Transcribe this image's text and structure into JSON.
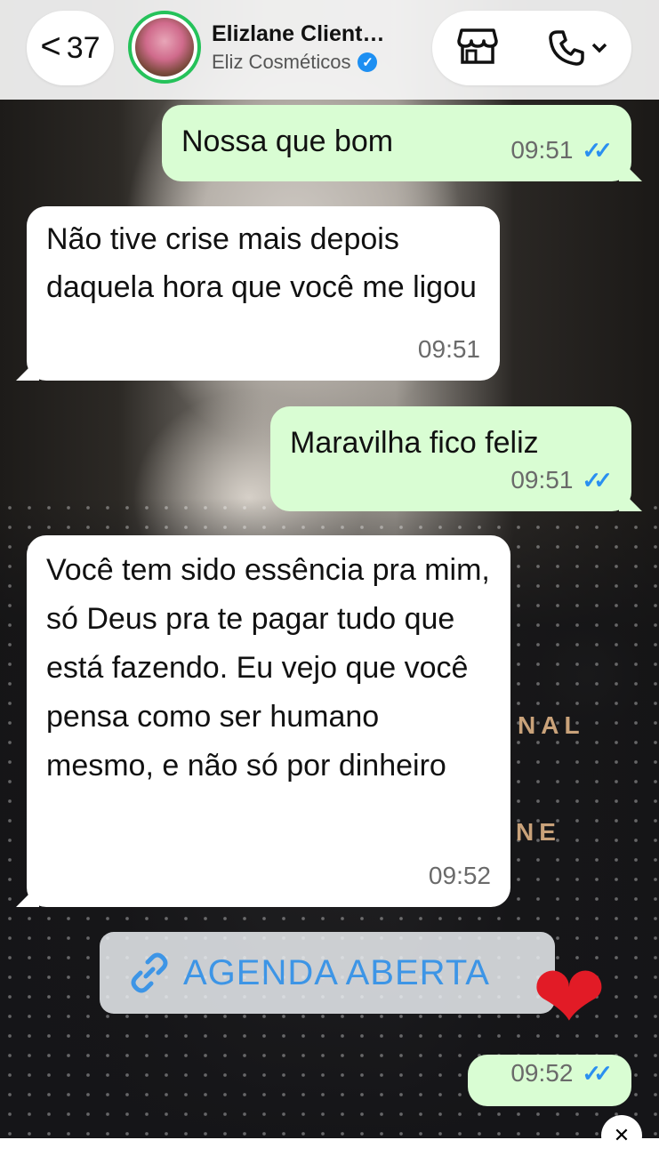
{
  "header": {
    "back_label": "<",
    "unread_count": "37",
    "contact_name": "Elizlane Client…",
    "business_name": "Eliz Cosméticos",
    "verified_mark": "✓"
  },
  "wallpaper_text": [
    "NAL",
    "NE"
  ],
  "messages": [
    {
      "direction": "out",
      "text": "Nossa que bom",
      "time": "09:51",
      "status": "read"
    },
    {
      "direction": "in",
      "text": "Não tive crise mais depois daquela hora que você me ligou",
      "time": "09:51"
    },
    {
      "direction": "out",
      "text": "Maravilha fico feliz",
      "time": "09:51",
      "status": "read"
    },
    {
      "direction": "in",
      "text": "Você tem sido essência pra mim, só Deus pra te pagar tudo que está fazendo. Eu vejo que você pensa como ser humano mesmo, e não só por dinheiro",
      "time": "09:52"
    },
    {
      "direction": "out",
      "text": "",
      "time": "09:52",
      "status": "read",
      "link_preview": "AGENDA ABERTA",
      "emoji": "❤"
    }
  ],
  "colors": {
    "outgoing_bubble": "#d9fdd3",
    "incoming_bubble": "#ffffff",
    "read_ticks": "#2a8ff0",
    "online_ring": "#25c25a",
    "verified_badge": "#1d8ff2"
  },
  "icons": [
    "chevron-left-icon",
    "store-icon",
    "phone-icon",
    "chevron-down-icon",
    "double-check-icon",
    "link-icon",
    "close-icon"
  ]
}
